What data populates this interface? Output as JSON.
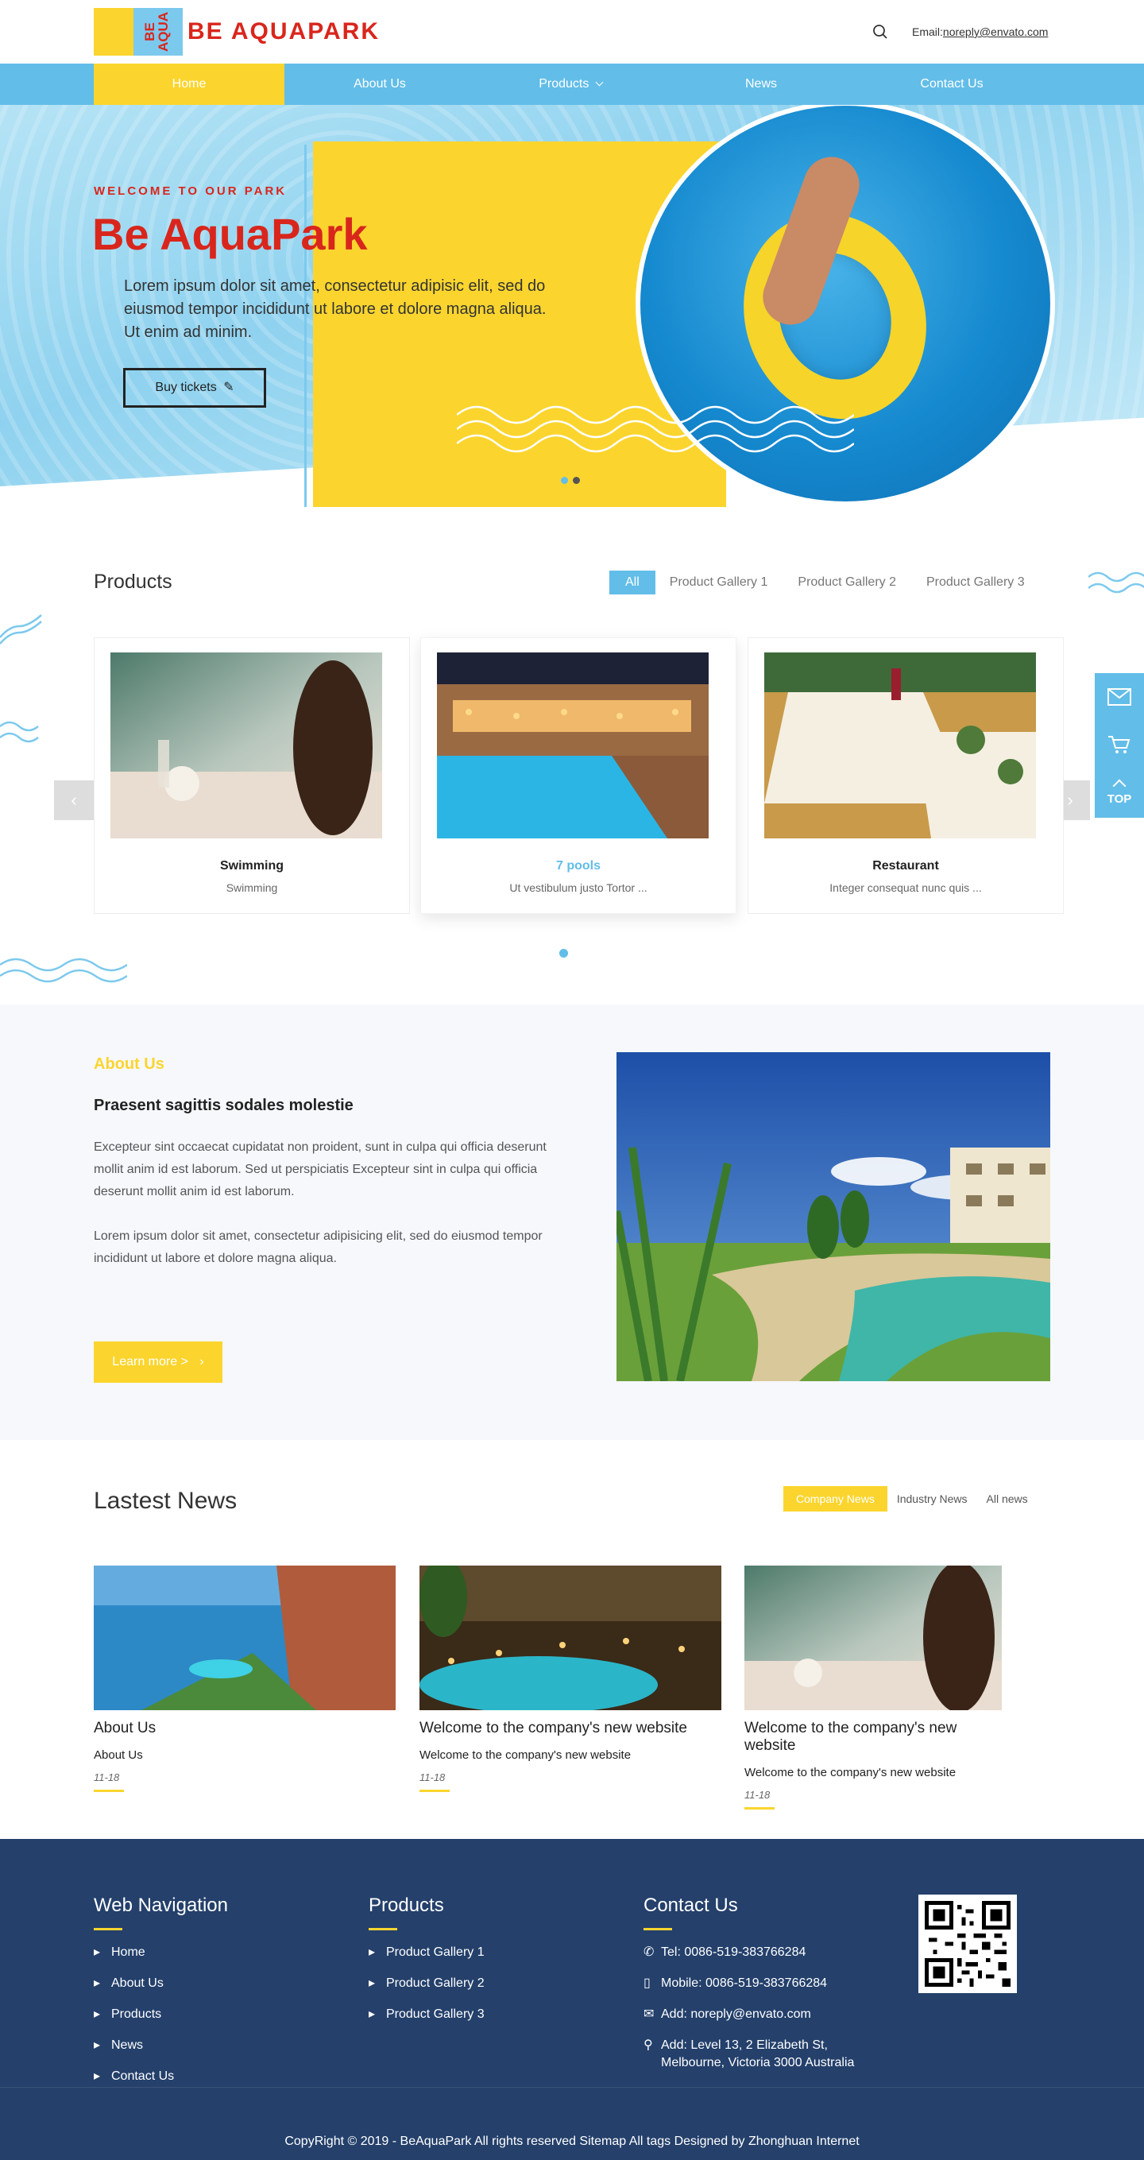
{
  "header": {
    "logo_mark_text": "BE AQUA",
    "logo_text": "BE AQUAPARK",
    "email_label": "Email:",
    "email_value": "noreply@envato.com"
  },
  "nav": {
    "items": [
      {
        "label": "Home"
      },
      {
        "label": "About Us"
      },
      {
        "label": "Products"
      },
      {
        "label": "News"
      },
      {
        "label": "Contact Us"
      }
    ]
  },
  "hero": {
    "kicker": "WELCOME TO OUR PARK",
    "title": "Be AquaPark",
    "text": "Lorem ipsum dolor sit amet, consectetur adipisic elit, sed do eiusmod tempor incididunt ut labore et dolore magna aliqua. Ut enim ad minim.",
    "button": "Buy tickets"
  },
  "products": {
    "title": "Products",
    "tabs": [
      "All",
      "Product Gallery 1",
      "Product Gallery 2",
      "Product Gallery 3"
    ],
    "cards": [
      {
        "title": "Swimming",
        "subtitle": "Swimming"
      },
      {
        "title": "7 pools",
        "subtitle": "Ut vestibulum justo Tortor ..."
      },
      {
        "title": "Restaurant",
        "subtitle": "Integer consequat nunc quis ..."
      }
    ],
    "prev": "‹",
    "next": "›"
  },
  "side": {
    "top_label": "TOP"
  },
  "about": {
    "heading": "About Us",
    "subheading": "Praesent sagittis sodales molestie",
    "p1": "Excepteur sint occaecat cupidatat non proident, sunt in culpa qui officia deserunt mollit anim id est laborum. Sed ut perspiciatis Excepteur sint in culpa qui officia deserunt mollit anim id est laborum.",
    "p2": "Lorem ipsum dolor sit amet, consectetur adipisicing elit, sed do eiusmod tempor incididunt ut labore et dolore magna aliqua.",
    "button": "Learn more >"
  },
  "news": {
    "title": "Lastest News",
    "tabs": [
      "Company News",
      "Industry News",
      "All news"
    ],
    "items": [
      {
        "title": "About Us",
        "summary": "About Us",
        "date": "11-18"
      },
      {
        "title": "Welcome to the company's new website",
        "summary": "Welcome to the company's new website",
        "date": "11-18"
      },
      {
        "title": "Welcome to the company's new website",
        "summary": "Welcome to the company's new website",
        "date": "11-18"
      }
    ]
  },
  "footer": {
    "nav_title": "Web Navigation",
    "nav_items": [
      "Home",
      "About Us",
      "Products",
      "News",
      "Contact Us"
    ],
    "products_title": "Products",
    "product_items": [
      "Product Gallery 1",
      "Product Gallery 2",
      "Product Gallery 3"
    ],
    "contact_title": "Contact Us",
    "tel": "Tel: 0086-519-383766284",
    "mobile": "Mobile: 0086-519-383766284",
    "email": "Add: noreply@envato.com",
    "address": "Add: Level 13, 2 Elizabeth St, Melbourne, Victoria 3000 Australia",
    "copyright": "CopyRight © 2019 -   BeAquaPark  All rights reserved Sitemap  All tags   Designed by Zhonghuan Internet"
  },
  "colors": {
    "accent_blue": "#62bde8",
    "accent_yellow": "#fbd52e",
    "brand_red": "#d9261c",
    "footer_bg": "#24406b"
  }
}
